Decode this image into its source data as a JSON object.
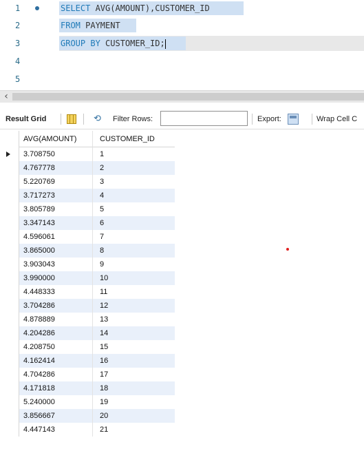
{
  "editor": {
    "lines": [
      {
        "number": "1",
        "keyword1": "SELECT ",
        "rest": "AVG(AMOUNT),CUSTOMER_ID",
        "keyword2": ""
      },
      {
        "number": "2",
        "keyword1": "FROM ",
        "rest": "PAYMENT",
        "keyword2": ""
      },
      {
        "number": "3",
        "keyword1": "GROUP BY ",
        "rest": "CUSTOMER_ID;",
        "keyword2": ""
      },
      {
        "number": "4",
        "keyword1": "",
        "rest": "",
        "keyword2": ""
      },
      {
        "number": "5",
        "keyword1": "",
        "rest": "",
        "keyword2": ""
      }
    ]
  },
  "toolbar": {
    "result_grid_label": "Result Grid",
    "filter_label": "Filter Rows:",
    "filter_value": "",
    "export_label": "Export:",
    "wrap_label": "Wrap Cell C"
  },
  "grid": {
    "columns": [
      "AVG(AMOUNT)",
      "CUSTOMER_ID"
    ],
    "rows": [
      [
        "3.708750",
        "1"
      ],
      [
        "4.767778",
        "2"
      ],
      [
        "5.220769",
        "3"
      ],
      [
        "3.717273",
        "4"
      ],
      [
        "3.805789",
        "5"
      ],
      [
        "3.347143",
        "6"
      ],
      [
        "4.596061",
        "7"
      ],
      [
        "3.865000",
        "8"
      ],
      [
        "3.903043",
        "9"
      ],
      [
        "3.990000",
        "10"
      ],
      [
        "4.448333",
        "11"
      ],
      [
        "3.704286",
        "12"
      ],
      [
        "4.878889",
        "13"
      ],
      [
        "4.204286",
        "14"
      ],
      [
        "4.208750",
        "15"
      ],
      [
        "4.162414",
        "16"
      ],
      [
        "4.704286",
        "17"
      ],
      [
        "4.171818",
        "18"
      ],
      [
        "5.240000",
        "19"
      ],
      [
        "3.856667",
        "20"
      ],
      [
        "4.447143",
        "21"
      ]
    ]
  },
  "icons": {
    "breakpoint": "breakpoint-dot-icon",
    "scroll_left": "chevron-left-icon",
    "grid_view": "grid-view-icon",
    "refresh": "refresh-icon",
    "export": "export-icon",
    "current_row": "row-pointer-icon"
  },
  "colors": {
    "keyword": "#1f7ab8",
    "selection": "#cfe0f3",
    "alt_row": "#e9f0fa"
  }
}
